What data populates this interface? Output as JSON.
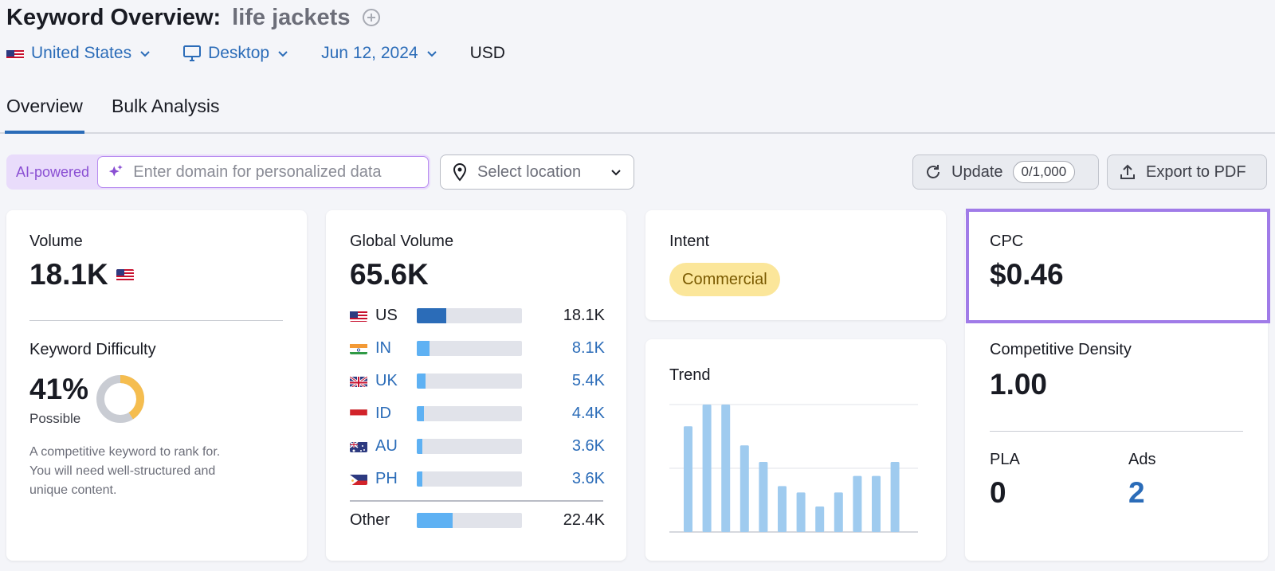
{
  "header": {
    "title": "Keyword Overview:",
    "keyword": "life jackets",
    "add_icon": "plus-circle-icon"
  },
  "filters": {
    "country": "United States",
    "device": "Desktop",
    "date": "Jun 12, 2024",
    "currency": "USD"
  },
  "tabs": [
    {
      "label": "Overview",
      "active": true
    },
    {
      "label": "Bulk Analysis",
      "active": false
    }
  ],
  "toolbar": {
    "ai_label": "AI-powered",
    "domain_placeholder": "Enter domain for personalized data",
    "location_placeholder": "Select location",
    "update_label": "Update",
    "update_quota": "0/1,000",
    "export_label": "Export to PDF"
  },
  "volume": {
    "label": "Volume",
    "value": "18.1K"
  },
  "difficulty": {
    "label": "Keyword Difficulty",
    "value": "41%",
    "percent": 41,
    "level": "Possible",
    "desc": [
      "A competitive keyword to rank for.",
      "You will need well-structured and",
      "unique content."
    ]
  },
  "global_volume": {
    "label": "Global Volume",
    "value": "65.6K",
    "countries": [
      {
        "code": "US",
        "value": "18.1K",
        "share": 0.28,
        "link": false
      },
      {
        "code": "IN",
        "value": "8.1K",
        "share": 0.12,
        "link": true
      },
      {
        "code": "UK",
        "value": "5.4K",
        "share": 0.08,
        "link": true
      },
      {
        "code": "ID",
        "value": "4.4K",
        "share": 0.07,
        "link": true
      },
      {
        "code": "AU",
        "value": "3.6K",
        "share": 0.05,
        "link": true
      },
      {
        "code": "PH",
        "value": "3.6K",
        "share": 0.05,
        "link": true
      }
    ],
    "other": {
      "label": "Other",
      "value": "22.4K",
      "share": 0.34
    }
  },
  "intent": {
    "label": "Intent",
    "value": "Commercial"
  },
  "trend": {
    "label": "Trend"
  },
  "chart_data": {
    "type": "bar",
    "values": [
      0.83,
      1.0,
      1.0,
      0.68,
      0.55,
      0.36,
      0.31,
      0.2,
      0.31,
      0.44,
      0.44,
      0.55
    ],
    "ylim": [
      0,
      1
    ],
    "grid": true
  },
  "cpc": {
    "label": "CPC",
    "value": "$0.46"
  },
  "density": {
    "label": "Competitive Density",
    "value": "1.00"
  },
  "pla": {
    "label": "PLA",
    "value": "0"
  },
  "ads": {
    "label": "Ads",
    "value": "2"
  },
  "colors": {
    "accent": "#2b6cb8",
    "highlight": "#a07be8",
    "bar": "#5eb1f3",
    "us_bar": "#2b6cb8",
    "trend_bar": "#9fcbef",
    "gauge": "#f5bd4f"
  }
}
